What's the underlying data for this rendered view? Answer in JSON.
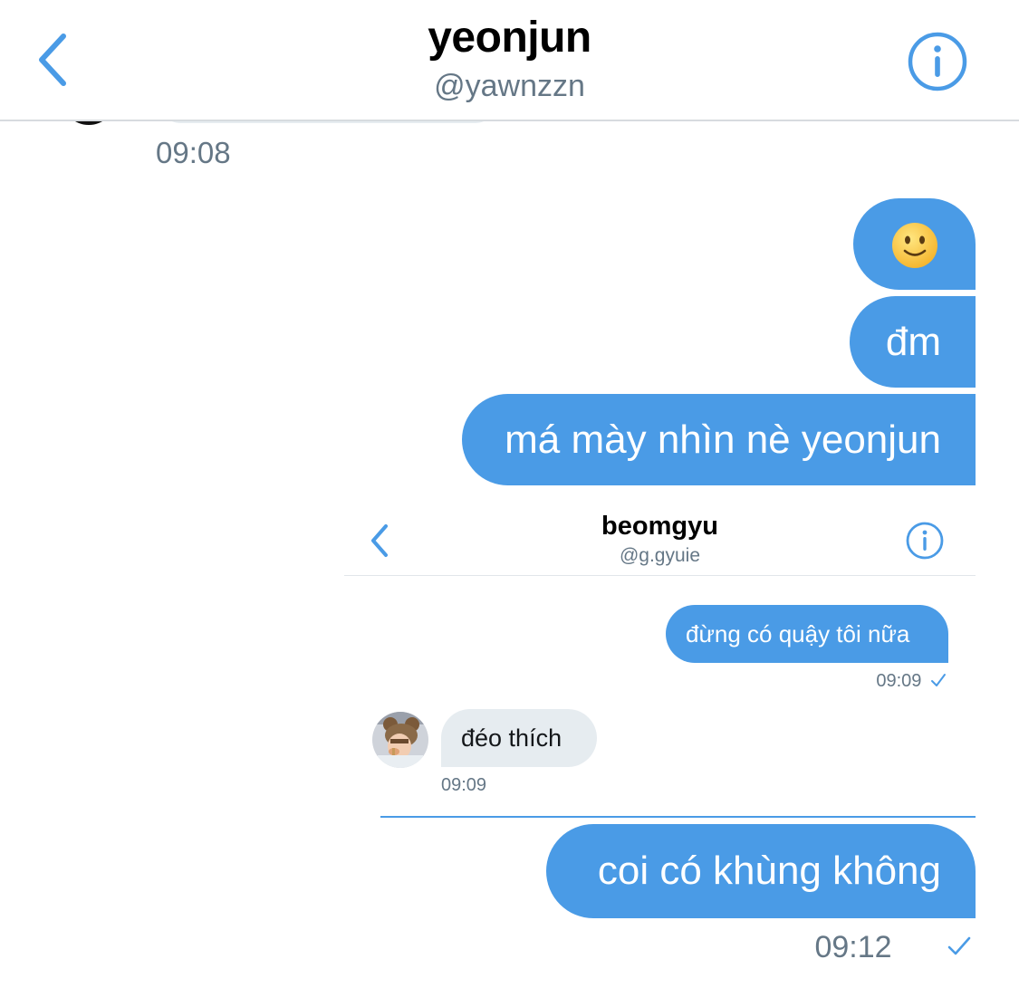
{
  "header": {
    "title": "yeonjun",
    "handle": "@yawnzzn",
    "back_icon": "chevron-left-icon",
    "info_icon": "info-circle-icon",
    "accent_color": "#4a9be6"
  },
  "messages": {
    "first_timestamp": "09:08",
    "outgoing_1_emoji": "slightly-smiling-face",
    "outgoing_2": "đm",
    "outgoing_3": "má mày nhìn nè yeonjun",
    "outgoing_4": "coi có khùng không",
    "last_timestamp": "09:12"
  },
  "embedded_screenshot": {
    "title": "beomgyu",
    "handle": "@g.gyuie",
    "outgoing_text": "đừng có quậy tôi nữa",
    "outgoing_time": "09:09",
    "incoming_text": "đéo thích",
    "incoming_time": "09:09"
  },
  "colors": {
    "bubble_out": "#4a9be6",
    "bubble_in": "#e6ecf0",
    "timestamp": "#657786"
  }
}
